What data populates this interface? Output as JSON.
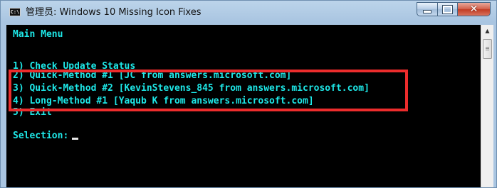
{
  "window": {
    "title": "管理员:  Windows 10 Missing Icon Fixes",
    "icon_text": "C:\\",
    "caption_buttons": {
      "minimize_glyph": "_",
      "maximize_glyph": "□",
      "close_glyph": "✕"
    }
  },
  "console": {
    "lines": {
      "header": "Main Menu",
      "opt1": "1) Check Update Status",
      "opt2": "2) Quick-Method #1 [JC from answers.microsoft.com]",
      "opt3": "3) Quick-Method #2 [KevinStevens_845 from answers.microsoft.com]",
      "opt4": "4) Long-Method #1 [Yaqub K from answers.microsoft.com]",
      "opt5": "5) Exit",
      "prompt": "Selection:"
    },
    "text_color": "#1ee8e8"
  },
  "annotation": {
    "highlight_color": "#ec2c2c"
  },
  "scrollbar": {
    "up_arrow": "▲"
  }
}
